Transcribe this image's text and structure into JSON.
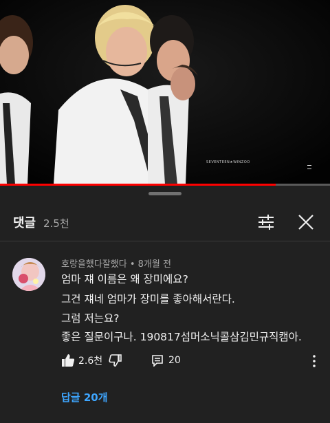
{
  "video": {
    "watermark": "SEVENTEEN★WINZOO",
    "progress_fraction": 0.835,
    "progress_color": "#ff0000"
  },
  "comments_panel": {
    "title": "댓글",
    "count": "2.5천",
    "filter_icon": "sliders-icon",
    "close_icon": "close-icon"
  },
  "comment": {
    "author": "호랑을했다잘했다",
    "time": "8개월 전",
    "meta_separator": " • ",
    "lines": [
      "엄마 쟤 이름은 왜 장미에요?",
      "그건 쟤네 엄마가 장미를 좋아해서란다.",
      "그럼 저는요?",
      "좋은 질문이구나. 190817섬머소닉콜삼김민규직캠아."
    ],
    "likes": "2.6천",
    "reply_count": "20",
    "replies_link": "답글 20개",
    "link_color": "#3ea6ff"
  }
}
